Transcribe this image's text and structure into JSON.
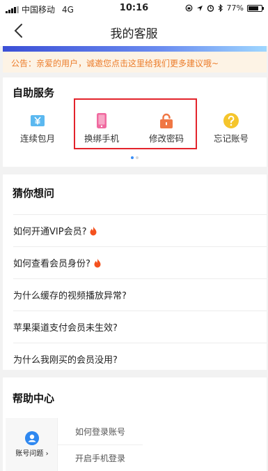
{
  "status_bar": {
    "carrier": "中国移动",
    "network": "4G",
    "time": "10:16",
    "battery_percent": "77%",
    "battery_level": 0.77
  },
  "nav": {
    "title": "我的客服",
    "back_icon": "chevron-left-icon"
  },
  "notice": {
    "text": "公告：亲爱的用户，诚邀您点击这里给我们更多建议哦~"
  },
  "self_service": {
    "title": "自助服务",
    "items": [
      {
        "label": "连续包月",
        "icon": "yen-icon",
        "color": "#5bb8f0"
      },
      {
        "label": "换绑手机",
        "icon": "phone-icon",
        "color": "#f06aa0"
      },
      {
        "label": "修改密码",
        "icon": "lock-icon",
        "color": "#f07744"
      },
      {
        "label": "忘记账号",
        "icon": "question-icon",
        "color": "#f5c52c"
      }
    ],
    "page_count": 2,
    "active_page": 1
  },
  "guess": {
    "title": "猜你想问",
    "questions": [
      {
        "text": "如何开通VIP会员?",
        "hot": true
      },
      {
        "text": "如何查看会员身份?",
        "hot": true
      },
      {
        "text": "为什么缓存的视频播放异常?",
        "hot": false
      },
      {
        "text": "苹果渠道支付会员未生效?",
        "hot": false
      },
      {
        "text": "为什么我刚买的会员没用?",
        "hot": false
      }
    ]
  },
  "help": {
    "title": "帮助中心",
    "category": "账号问题",
    "links": [
      "如何登录账号",
      "开启手机登录"
    ]
  },
  "colors": {
    "highlight_box": "#e3232b",
    "notice_text": "#ec7c2a",
    "notice_bg": "#fdf3e5",
    "hot_icon": "#f4511e",
    "avatar": "#2f88f0"
  }
}
